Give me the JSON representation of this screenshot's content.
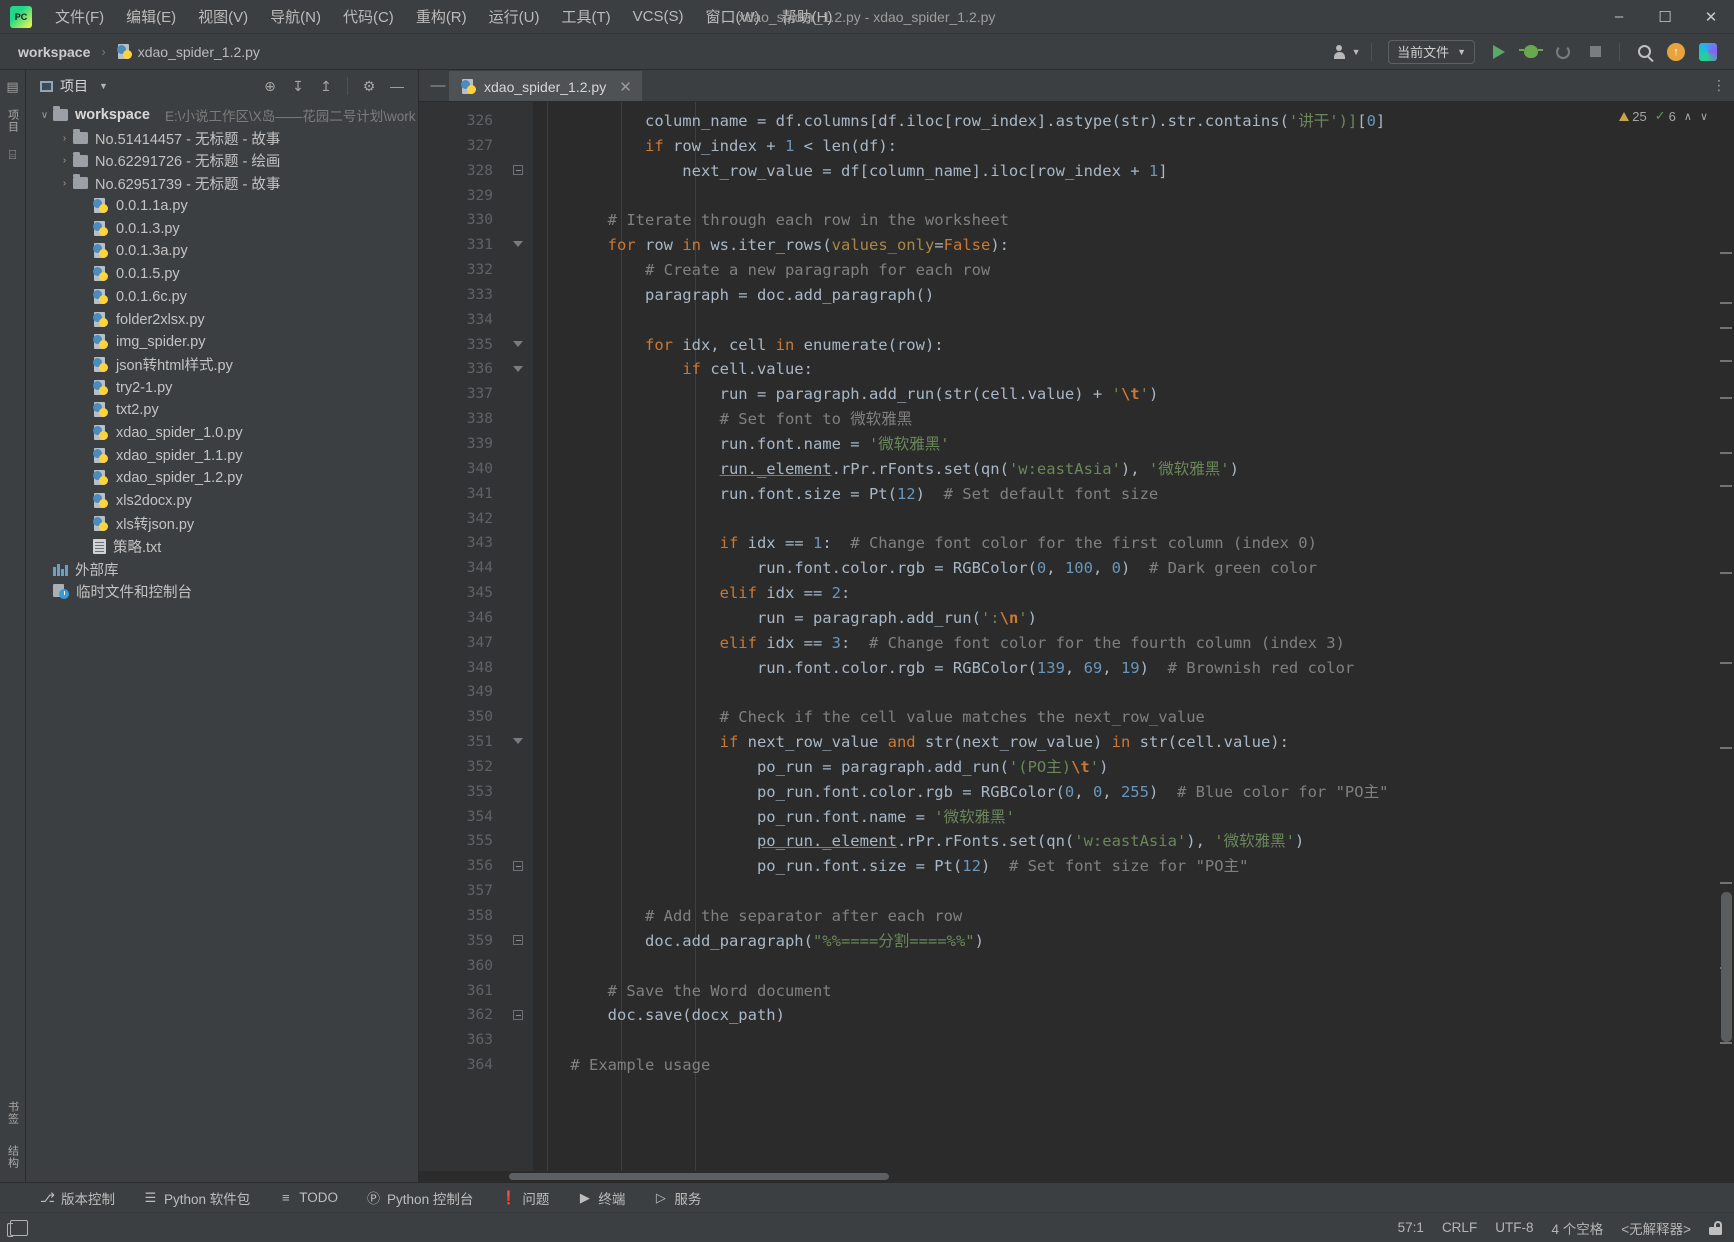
{
  "window": {
    "title": "xdao_spider_1.2.py - xdao_spider_1.2.py",
    "minimize": "–",
    "maximize": "☐",
    "close": "✕",
    "logo_text": "PC"
  },
  "menu": [
    {
      "label": "文件(F)"
    },
    {
      "label": "编辑(E)"
    },
    {
      "label": "视图(V)"
    },
    {
      "label": "导航(N)"
    },
    {
      "label": "代码(C)"
    },
    {
      "label": "重构(R)"
    },
    {
      "label": "运行(U)"
    },
    {
      "label": "工具(T)"
    },
    {
      "label": "VCS(S)"
    },
    {
      "label": "窗口(W)"
    },
    {
      "label": "帮助(H)"
    }
  ],
  "navbar": {
    "crumb_root": "workspace",
    "crumb_sep": "›",
    "crumb_file": "xdao_spider_1.2.py",
    "run_config": "当前文件",
    "run_config_caret": "▼"
  },
  "left_strip": {
    "top_label": "项目",
    "bottom_labels": [
      "书签",
      "结构"
    ]
  },
  "project_panel": {
    "title": "项目",
    "title_caret": "▼",
    "tools": [
      "⊕",
      "↧",
      "↥",
      "⚙",
      "—"
    ],
    "tree": [
      {
        "indent": 0,
        "arrow": "∨",
        "icon": "folder",
        "label": "workspace",
        "bold": true,
        "hint": "E:\\小说工作区\\X岛——花园二号计划\\work"
      },
      {
        "indent": 1,
        "arrow": "›",
        "icon": "folder",
        "label": "No.51414457 - 无标题 - 故事",
        "bold": false,
        "hint": ""
      },
      {
        "indent": 1,
        "arrow": "›",
        "icon": "folder",
        "label": "No.62291726 - 无标题 - 绘画",
        "bold": false,
        "hint": ""
      },
      {
        "indent": 1,
        "arrow": "›",
        "icon": "folder",
        "label": "No.62951739 - 无标题 - 故事",
        "bold": false,
        "hint": ""
      },
      {
        "indent": 2,
        "arrow": "",
        "icon": "py",
        "label": "0.0.1.1a.py",
        "bold": false,
        "hint": ""
      },
      {
        "indent": 2,
        "arrow": "",
        "icon": "py",
        "label": "0.0.1.3.py",
        "bold": false,
        "hint": ""
      },
      {
        "indent": 2,
        "arrow": "",
        "icon": "py",
        "label": "0.0.1.3a.py",
        "bold": false,
        "hint": ""
      },
      {
        "indent": 2,
        "arrow": "",
        "icon": "py",
        "label": "0.0.1.5.py",
        "bold": false,
        "hint": ""
      },
      {
        "indent": 2,
        "arrow": "",
        "icon": "py",
        "label": "0.0.1.6c.py",
        "bold": false,
        "hint": ""
      },
      {
        "indent": 2,
        "arrow": "",
        "icon": "py",
        "label": "folder2xlsx.py",
        "bold": false,
        "hint": ""
      },
      {
        "indent": 2,
        "arrow": "",
        "icon": "py",
        "label": "img_spider.py",
        "bold": false,
        "hint": ""
      },
      {
        "indent": 2,
        "arrow": "",
        "icon": "py",
        "label": "json转html样式.py",
        "bold": false,
        "hint": ""
      },
      {
        "indent": 2,
        "arrow": "",
        "icon": "py",
        "label": "try2-1.py",
        "bold": false,
        "hint": ""
      },
      {
        "indent": 2,
        "arrow": "",
        "icon": "py",
        "label": "txt2.py",
        "bold": false,
        "hint": ""
      },
      {
        "indent": 2,
        "arrow": "",
        "icon": "py",
        "label": "xdao_spider_1.0.py",
        "bold": false,
        "hint": ""
      },
      {
        "indent": 2,
        "arrow": "",
        "icon": "py",
        "label": "xdao_spider_1.1.py",
        "bold": false,
        "hint": ""
      },
      {
        "indent": 2,
        "arrow": "",
        "icon": "py",
        "label": "xdao_spider_1.2.py",
        "bold": false,
        "hint": ""
      },
      {
        "indent": 2,
        "arrow": "",
        "icon": "py",
        "label": "xls2docx.py",
        "bold": false,
        "hint": ""
      },
      {
        "indent": 2,
        "arrow": "",
        "icon": "py",
        "label": "xls转json.py",
        "bold": false,
        "hint": ""
      },
      {
        "indent": 2,
        "arrow": "",
        "icon": "txt",
        "label": "策略.txt",
        "bold": false,
        "hint": ""
      },
      {
        "indent": 0,
        "arrow": "",
        "icon": "lib",
        "label": "外部库",
        "bold": false,
        "hint": ""
      },
      {
        "indent": 0,
        "arrow": "",
        "icon": "scratch",
        "label": "临时文件和控制台",
        "bold": false,
        "hint": ""
      }
    ]
  },
  "editor": {
    "tab_label": "xdao_spider_1.2.py",
    "tab_close": "✕",
    "collapse_icon": "—",
    "inspection": {
      "warnings": "25",
      "checks": "6",
      "up": "∧",
      "down": "∨"
    },
    "first_line_number": 326,
    "lines": [
      {
        "n": 326,
        "fold": "",
        "html": "            <span class='fn'>column_name</span> = df.columns[df.iloc[row_index].astype(<span class='fn'>str</span>).str.contains(<span class='str'>'讲干')]</span>[<span class='num'>0</span>]"
      },
      {
        "n": 327,
        "fold": "",
        "html": "            <span class='kw'>if</span> row_index + <span class='num'>1</span> &lt; len(df):"
      },
      {
        "n": 328,
        "fold": "box",
        "html": "                next_row_value = df[column_name].iloc[row_index + <span class='num'>1</span>]"
      },
      {
        "n": 329,
        "fold": "",
        "html": ""
      },
      {
        "n": 330,
        "fold": "",
        "html": "        <span class='cmt'># Iterate through each row in the worksheet</span>"
      },
      {
        "n": 331,
        "fold": "arrow",
        "html": "        <span class='kw'>for</span> row <span class='kw'>in</span> ws.iter_rows(<span class='kwarg'>values_only</span>=<span class='kw'>False</span>):"
      },
      {
        "n": 332,
        "fold": "",
        "html": "            <span class='cmt'># Create a new paragraph for each row</span>"
      },
      {
        "n": 333,
        "fold": "",
        "html": "            paragraph = doc.add_paragraph()"
      },
      {
        "n": 334,
        "fold": "",
        "html": ""
      },
      {
        "n": 335,
        "fold": "arrow",
        "html": "            <span class='kw'>for</span> idx, cell <span class='kw'>in</span> enumerate(row):"
      },
      {
        "n": 336,
        "fold": "arrow",
        "html": "                <span class='kw'>if</span> cell.value:"
      },
      {
        "n": 337,
        "fold": "",
        "html": "                    run = paragraph.add_run(<span class='fn'>str</span>(cell.value) + <span class='str'>'</span><span class='kwb'>\\t</span><span class='str'>'</span>)"
      },
      {
        "n": 338,
        "fold": "",
        "html": "                    <span class='cmt'># Set font to 微软雅黑</span>"
      },
      {
        "n": 339,
        "fold": "",
        "html": "                    run.font.name = <span class='str'>'微软雅黑'</span>"
      },
      {
        "n": 340,
        "fold": "",
        "html": "                    <span class='und'>run._element</span>.rPr.rFonts.set(qn(<span class='str'>'w:eastAsia'</span>), <span class='str'>'微软雅黑'</span>)"
      },
      {
        "n": 341,
        "fold": "",
        "html": "                    run.font.size = Pt(<span class='num'>12</span>)  <span class='cmt'># Set default font size</span>"
      },
      {
        "n": 342,
        "fold": "",
        "html": ""
      },
      {
        "n": 343,
        "fold": "",
        "html": "                    <span class='kw'>if</span> idx == <span class='num'>1</span>:  <span class='cmt'># Change font color for the first column (index 0)</span>"
      },
      {
        "n": 344,
        "fold": "",
        "html": "                        run.font.color.rgb = RGBColor(<span class='num'>0</span>, <span class='num'>100</span>, <span class='num'>0</span>)  <span class='cmt'># Dark green color</span>"
      },
      {
        "n": 345,
        "fold": "",
        "html": "                    <span class='kw'>elif</span> idx == <span class='num'>2</span>:"
      },
      {
        "n": 346,
        "fold": "",
        "html": "                        run = paragraph.add_run(<span class='str'>':</span><span class='kwb'>\\n</span><span class='str'>'</span>)"
      },
      {
        "n": 347,
        "fold": "",
        "html": "                    <span class='kw'>elif</span> idx == <span class='num'>3</span>:  <span class='cmt'># Change font color for the fourth column (index 3)</span>"
      },
      {
        "n": 348,
        "fold": "",
        "html": "                        run.font.color.rgb = RGBColor(<span class='num'>139</span>, <span class='num'>69</span>, <span class='num'>19</span>)  <span class='cmt'># Brownish red color</span>"
      },
      {
        "n": 349,
        "fold": "",
        "html": ""
      },
      {
        "n": 350,
        "fold": "",
        "html": "                    <span class='cmt'># Check if the cell value matches the next_row_value</span>"
      },
      {
        "n": 351,
        "fold": "arrow",
        "html": "                    <span class='kw'>if</span> next_row_value <span class='kw'>and</span> <span class='fn'>str</span>(next_row_value) <span class='kw'>in</span> <span class='fn'>str</span>(cell.value):"
      },
      {
        "n": 352,
        "fold": "",
        "html": "                        po_run = paragraph.add_run(<span class='str'>'(PO主)</span><span class='kwb'>\\t</span><span class='str'>'</span>)"
      },
      {
        "n": 353,
        "fold": "",
        "html": "                        po_run.font.color.rgb = RGBColor(<span class='num'>0</span>, <span class='num'>0</span>, <span class='num'>255</span>)  <span class='cmt'># Blue color for \"PO主\"</span>"
      },
      {
        "n": 354,
        "fold": "",
        "html": "                        po_run.font.name = <span class='str'>'微软雅黑'</span>"
      },
      {
        "n": 355,
        "fold": "",
        "html": "                        <span class='und'>po_run._element</span>.rPr.rFonts.set(qn(<span class='str'>'w:eastAsia'</span>), <span class='str'>'微软雅黑'</span>)"
      },
      {
        "n": 356,
        "fold": "box",
        "html": "                        po_run.font.size = Pt(<span class='num'>12</span>)  <span class='cmt'># Set font size for \"PO主\"</span>"
      },
      {
        "n": 357,
        "fold": "",
        "html": ""
      },
      {
        "n": 358,
        "fold": "",
        "html": "            <span class='cmt'># Add the separator after each row</span>"
      },
      {
        "n": 359,
        "fold": "box",
        "html": "            doc.add_paragraph(<span class='str'>\"%%====分割====%%\"</span>)"
      },
      {
        "n": 360,
        "fold": "",
        "html": ""
      },
      {
        "n": 361,
        "fold": "",
        "html": "        <span class='cmt'># Save the Word document</span>"
      },
      {
        "n": 362,
        "fold": "box",
        "html": "        doc.save(docx_path)"
      },
      {
        "n": 363,
        "fold": "",
        "html": ""
      },
      {
        "n": 364,
        "fold": "",
        "html": "    <span class='cmt'># Example usage</span>"
      }
    ]
  },
  "bottom_bar": [
    {
      "icon": "⎇",
      "label": "版本控制"
    },
    {
      "icon": "☰",
      "label": "Python 软件包"
    },
    {
      "icon": "≡",
      "label": "TODO"
    },
    {
      "icon": "Ⓟ",
      "label": "Python 控制台"
    },
    {
      "icon": "❗",
      "label": "问题"
    },
    {
      "icon": "▶",
      "label": "终端"
    },
    {
      "icon": "▷",
      "label": "服务"
    }
  ],
  "status_bar": {
    "caret": "57:1",
    "line_sep": "CRLF",
    "encoding": "UTF-8",
    "indent": "4 个空格",
    "interpreter": "<无解释器>"
  }
}
